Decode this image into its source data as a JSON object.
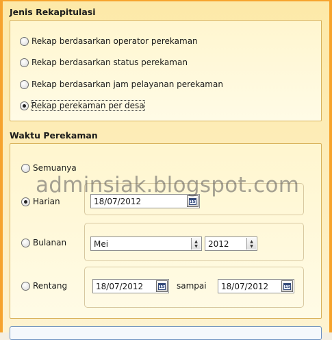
{
  "jenis": {
    "title": "Jenis Rekapitulasi",
    "options": [
      {
        "label": "Rekap berdasarkan operator perekaman",
        "checked": false
      },
      {
        "label": "Rekap berdasarkan status perekaman",
        "checked": false
      },
      {
        "label": "Rekap berdasarkan jam pelayanan perekaman",
        "checked": false
      },
      {
        "label": "Rekap perekaman per desa",
        "checked": true
      }
    ]
  },
  "waktu": {
    "title": "Waktu Perekaman",
    "semuanya": {
      "label": "Semuanya",
      "checked": false
    },
    "harian": {
      "label": "Harian",
      "checked": true,
      "date": "18/07/2012"
    },
    "bulanan": {
      "label": "Bulanan",
      "checked": false,
      "month": "Mei",
      "year": "2012"
    },
    "rentang": {
      "label": "Rentang",
      "checked": false,
      "from": "18/07/2012",
      "to_label": "sampai",
      "to": "18/07/2012"
    }
  },
  "icons": {
    "calendar": "calendar-icon",
    "spinner": "spinner-icon"
  },
  "calendar_glyph": "15",
  "watermark": "adminsiak.blogspot.com",
  "colors": {
    "frame": "#f6a32d",
    "group_border": "#d8b15a",
    "panel_bg": "#fff6cf"
  }
}
